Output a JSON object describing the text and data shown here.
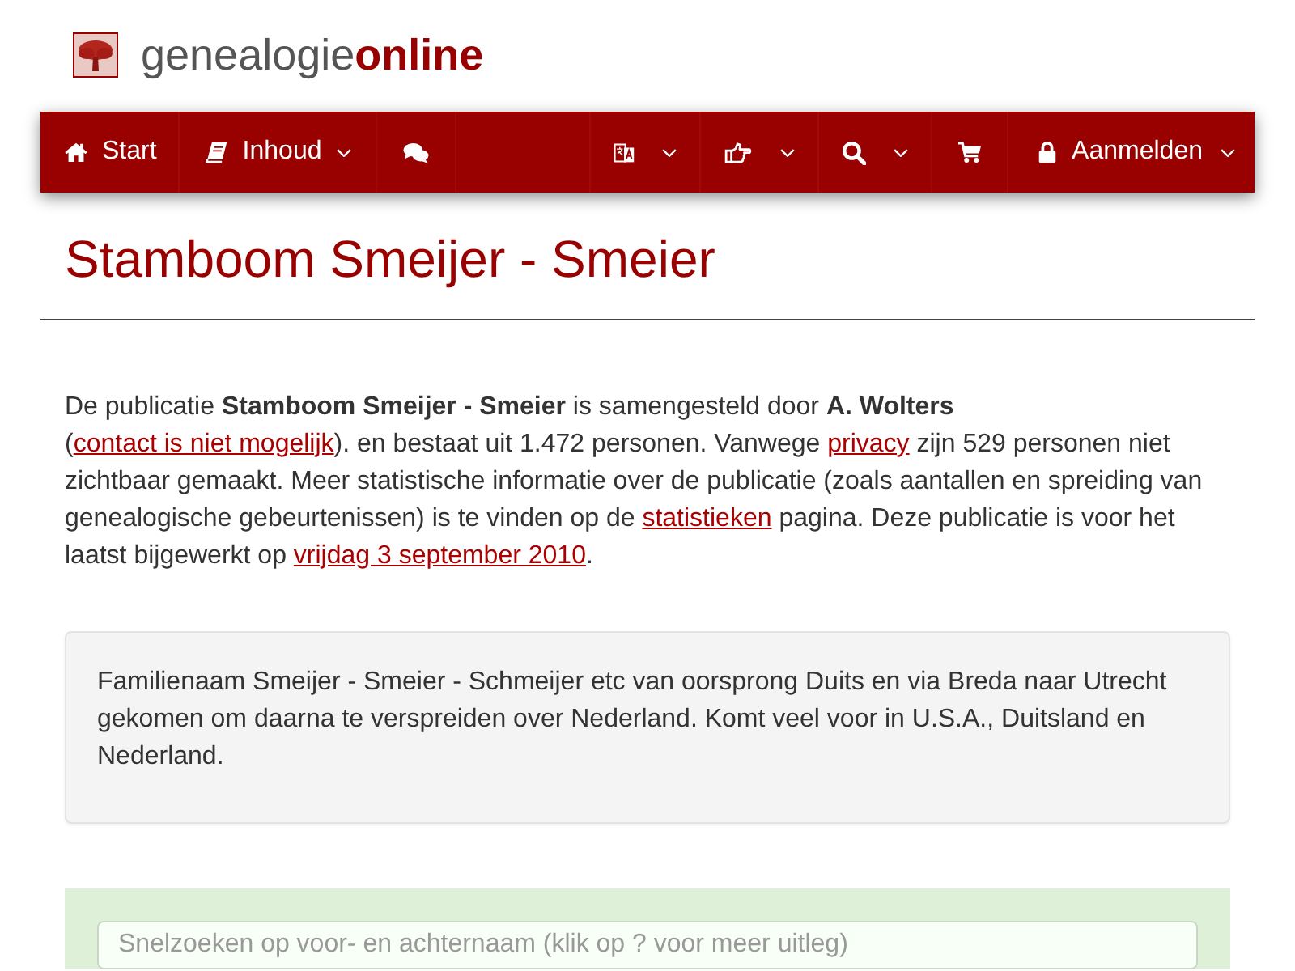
{
  "brand": "genealogie**online**",
  "nav": {
    "left": [
      {
        "label": "Start",
        "dropdown": false
      },
      {
        "label": "Inhoud",
        "dropdown": true
      },
      {
        "dropdown": false
      }
    ],
    "right": [
      {
        "dropdown": true
      },
      {
        "dropdown": true
      },
      {
        "dropdown": true
      },
      {
        "dropdown": false
      },
      {
        "label": "Aanmelden",
        "dropdown": true
      }
    ]
  },
  "title": "Stamboom Smeijer - Smeier",
  "intro": [
    {
      "kind": "text",
      "text": "De publicatie **Stamboom Smeijer - Smeier** is samengesteld door **A. Wolters** ("
    },
    {
      "kind": "link",
      "text": "contact is niet mogelijk"
    },
    {
      "kind": "text",
      "text": "). en bestaat uit 1.472 personen. Vanwege "
    },
    {
      "kind": "link",
      "text": "privacy"
    },
    {
      "kind": "text",
      "text": " zijn 529 personen niet zichtbaar gemaakt. Meer statistische informatie over de publicatie (zoals aantallen en spreiding van genealogische gebeurtenissen) is te vinden op de "
    },
    {
      "kind": "link",
      "text": "statistieken"
    },
    {
      "kind": "text",
      "text": " pagina. Deze publicatie is voor het laatst bijgewerkt op "
    },
    {
      "kind": "link",
      "text": "vrijdag 3 september 2010"
    },
    {
      "kind": "text",
      "text": "."
    }
  ],
  "description": "Familienaam Smeijer - Smeier - Schmeijer etc van oorsprong Duits en via Breda naar Utrecht gekomen om daarna te verspreiden over Nederland. Komt veel voor in U.S.A., Duitsland en Nederland.",
  "search": {
    "placeholder": "Snelzoeken op voor- en achternaam (klik op ? voor meer uitleg)"
  }
}
